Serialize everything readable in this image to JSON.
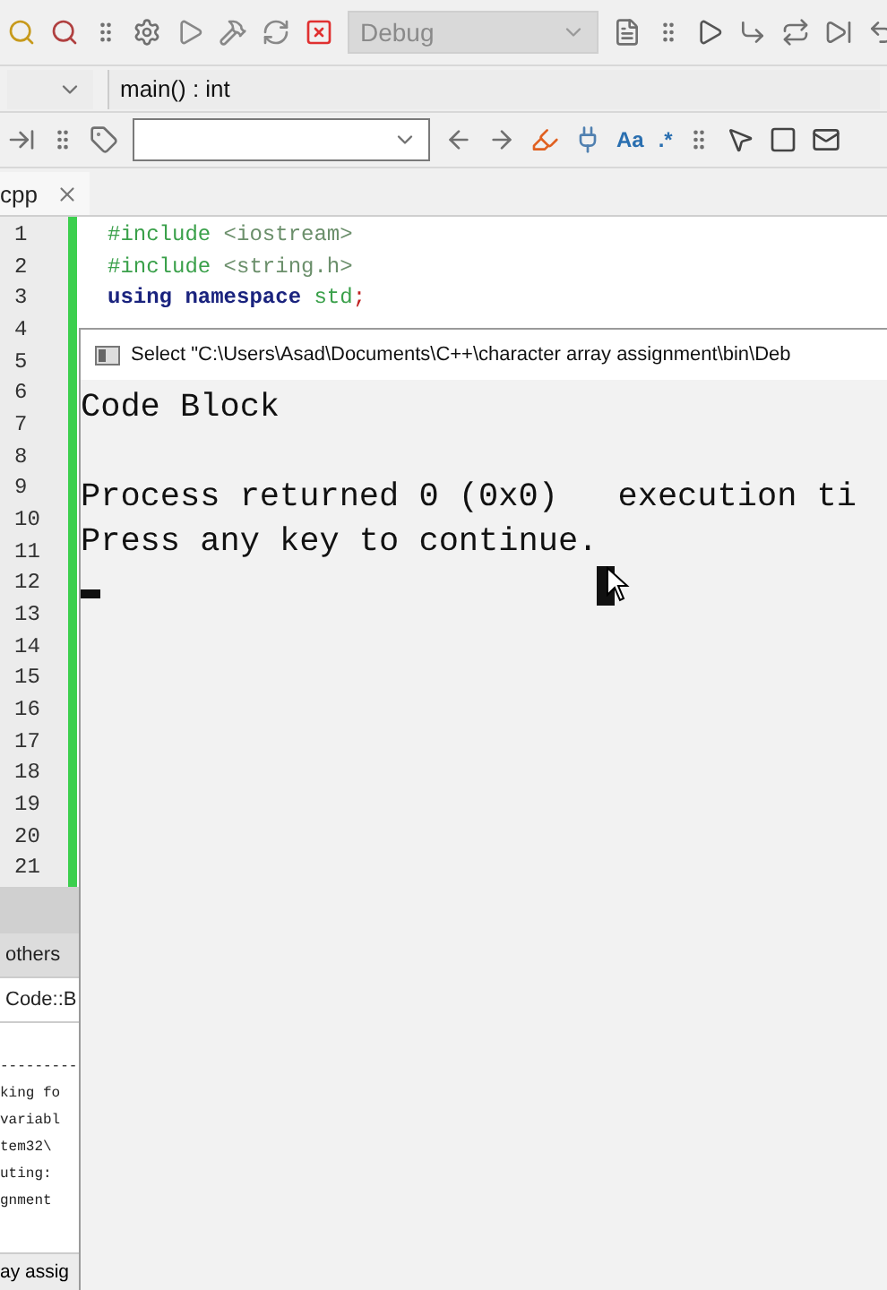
{
  "toolbar": {
    "build_target": {
      "value": "Debug",
      "disabled": true
    }
  },
  "scope_bar": {
    "function": "main() : int"
  },
  "search_bar": {
    "match_case_label": "Aa",
    "regex_label": ".*"
  },
  "editor_tabs": [
    {
      "label": "cpp",
      "selected": true
    }
  ],
  "editor": {
    "line_numbers": [
      "1",
      "2",
      "3",
      "4",
      "5",
      "6",
      "7",
      "8",
      "9",
      "10",
      "11",
      "12",
      "13",
      "14",
      "15",
      "16",
      "17",
      "18",
      "19",
      "20",
      "21"
    ],
    "code_lines": [
      [
        {
          "kind": "preprocessor",
          "text": "#include"
        },
        {
          "kind": "header",
          "text": " <iostream>"
        }
      ],
      [
        {
          "kind": "preprocessor",
          "text": "#include"
        },
        {
          "kind": "header",
          "text": " <string.h>"
        }
      ],
      [
        {
          "kind": "keyword",
          "text": "using namespace"
        },
        {
          "kind": "identifier",
          "text": " std"
        },
        {
          "kind": "operator",
          "text": ";"
        }
      ]
    ]
  },
  "bottom_panel": {
    "tabs": [
      {
        "label": "others",
        "selected": false
      },
      {
        "label": "Code::B",
        "selected": true
      }
    ],
    "log_lines": [
      "---------",
      "king fo",
      "variabl",
      "tem32\\",
      "uting:",
      "gnment"
    ],
    "status_text": "ay assig"
  },
  "console": {
    "title": "Select \"C:\\Users\\Asad\\Documents\\C++\\character array assignment\\bin\\Deb",
    "program_output": "Code Block",
    "status_lines": [
      "Process returned 0 (0x0)   execution ti",
      "Press any key to continue."
    ]
  }
}
